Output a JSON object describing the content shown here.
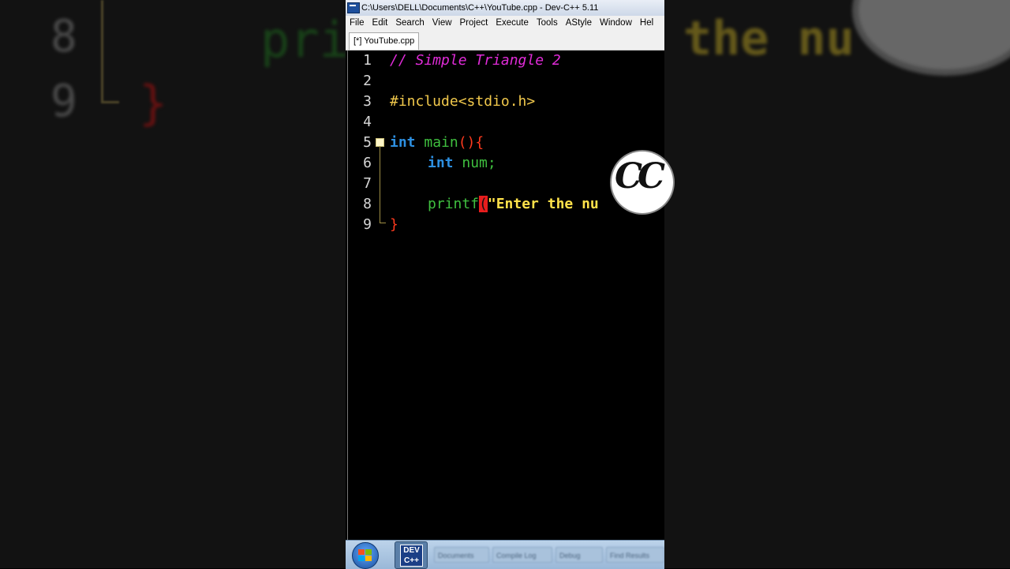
{
  "window": {
    "title": "C:\\Users\\DELL\\Documents\\C++\\YouTube.cpp - Dev-C++ 5.11"
  },
  "menu": [
    {
      "label": "File"
    },
    {
      "label": "Edit"
    },
    {
      "label": "Search"
    },
    {
      "label": "View"
    },
    {
      "label": "Project"
    },
    {
      "label": "Execute"
    },
    {
      "label": "Tools"
    },
    {
      "label": "AStyle"
    },
    {
      "label": "Window"
    },
    {
      "label": "Hel"
    }
  ],
  "tab": {
    "label": "[*] YouTube.cpp"
  },
  "editor": {
    "line_numbers": [
      "1",
      "2",
      "3",
      "4",
      "5",
      "6",
      "7",
      "8",
      "9"
    ],
    "line1_comment": "// Simple Triangle 2",
    "line3_include": "#include<stdio.h>",
    "line5_kw": "int",
    "line5_fn": " main",
    "line5_paren": "(){",
    "line6_kw": "int",
    "line6_rest": " num;",
    "line8_fn": "printf",
    "line8_paren": "(",
    "line8_str": "\"Enter the nu",
    "line9_brace": "}"
  },
  "overlay_logo": {
    "text": "CC"
  },
  "taskbar": {
    "dev_label": "DEV",
    "dev_sub": "C++",
    "items": [
      "Documents",
      "Compile Log",
      "Debug",
      "Find Results"
    ]
  },
  "background": {
    "left_line8": "8",
    "left_line9": "9",
    "left_brace": "}",
    "left_printf": "pri",
    "right_text": "the nu"
  },
  "colors": {
    "comment": "#e02bd8",
    "preprocessor": "#f2c94c",
    "keyword": "#2d8fe0",
    "function": "#3fbf3f",
    "bracket": "#ff3a1e",
    "string": "#ffe24a"
  }
}
